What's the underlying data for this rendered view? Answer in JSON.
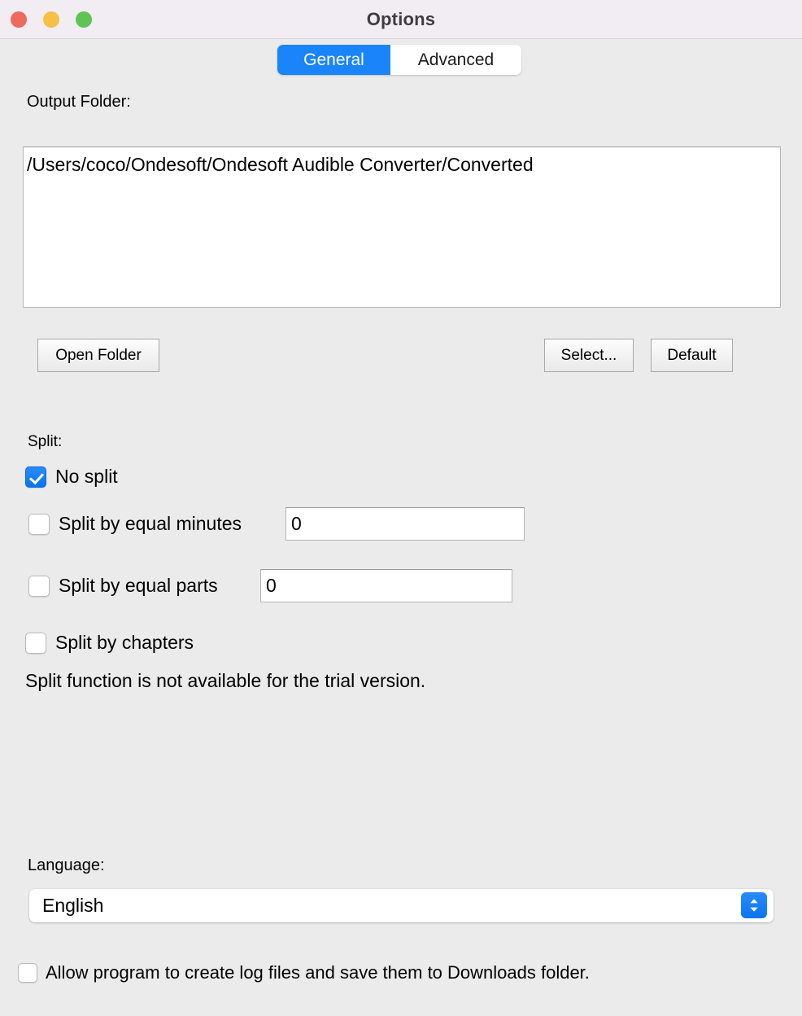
{
  "window": {
    "title": "Options",
    "traffic_lights": [
      {
        "name": "close",
        "color": "#ec6a5e"
      },
      {
        "name": "minimize",
        "color": "#f5c046"
      },
      {
        "name": "maximize",
        "color": "#5fc455"
      }
    ]
  },
  "tabs": [
    {
      "label": "General",
      "active": true
    },
    {
      "label": "Advanced",
      "active": false
    }
  ],
  "output_folder": {
    "label": "Output Folder:",
    "path": "/Users/coco/Ondesoft/Ondesoft Audible Converter/Converted",
    "buttons": {
      "open_folder": "Open Folder",
      "select": "Select...",
      "default": "Default"
    }
  },
  "split": {
    "label": "Split:",
    "options": [
      {
        "id": "no-split",
        "label": "No split",
        "checked": true
      },
      {
        "id": "split-minutes",
        "label": "Split by equal minutes",
        "checked": false,
        "value": "0"
      },
      {
        "id": "split-parts",
        "label": "Split by equal parts",
        "checked": false,
        "value": "0"
      },
      {
        "id": "split-chapters",
        "label": "Split by chapters",
        "checked": false
      }
    ],
    "notice": "Split function is not available for the trial version."
  },
  "language": {
    "label": "Language:",
    "selected": "English"
  },
  "logging": {
    "label": "Allow program to create log files and save them to Downloads folder.",
    "checked": false
  },
  "colors": {
    "accent": "#0a74f0",
    "titlebar_bg": "#f1edf2",
    "window_bg": "#ebebeb"
  }
}
